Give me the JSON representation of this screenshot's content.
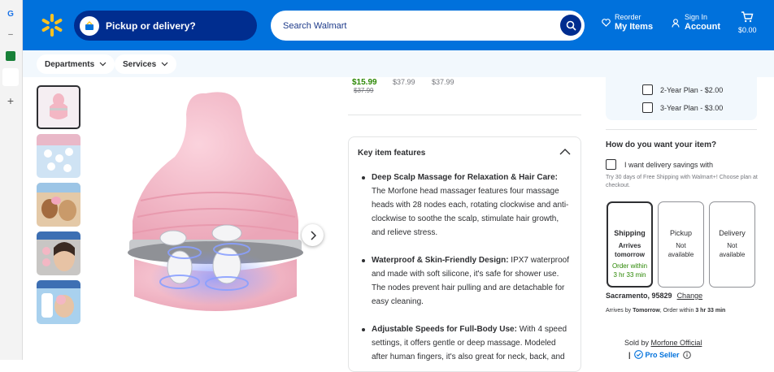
{
  "header": {
    "pickup_label": "Pickup or delivery?",
    "search_placeholder": "Search Walmart",
    "reorder_small": "Reorder",
    "reorder_big": "My Items",
    "signin_small": "Sign In",
    "signin_big": "Account",
    "cart_total": "$0.00"
  },
  "subnav": {
    "departments": "Departments",
    "services": "Services"
  },
  "prices": {
    "current": "$15.99",
    "was": "$37.99",
    "alt1": "$37.99",
    "alt2": "$37.99"
  },
  "key_features": {
    "title": "Key item features",
    "items": [
      {
        "bold": "Deep Scalp Massage for Relaxation & Hair Care:",
        "text": " The Morfone head massager features four massage heads with 28 nodes each, rotating clockwise and anti-clockwise to soothe the scalp, stimulate hair growth, and relieve stress."
      },
      {
        "bold": "Waterproof & Skin-Friendly Design:",
        "text": " IPX7 waterproof and made with soft silicone, it's safe for shower use. The nodes prevent hair pulling and are detachable for easy cleaning."
      },
      {
        "bold": "Adjustable Speeds for Full-Body Use:",
        "text": " With 4 speed settings, it offers gentle or deep massage. Modeled after human fingers, it's also great for neck, back, and"
      }
    ]
  },
  "protection": {
    "plan2": "2-Year Plan - $2.00",
    "plan3": "3-Year Plan - $3.00"
  },
  "fulfillment": {
    "question": "How do you want your item?",
    "savings_label": "I want delivery savings with",
    "savings_sub": "Try 30 days of Free Shipping with Walmart+! Choose plan at checkout.",
    "options": [
      {
        "name": "Shipping",
        "l1": "Arrives",
        "l2": "tomorrow",
        "l3": "Order within",
        "l4": "3 hr 33 min"
      },
      {
        "name": "Pickup",
        "l1": "Not",
        "l2": "available"
      },
      {
        "name": "Delivery",
        "l1": "Not",
        "l2": "available"
      }
    ],
    "location": "Sacramento, 95829",
    "change": "Change",
    "arrives_a": "Arrives by ",
    "arrives_b": "Tomorrow",
    "arrives_c": ", Order within ",
    "arrives_d": "3 hr 33 min",
    "sold_by": "Sold by ",
    "seller": "Morfone Official",
    "pro": "Pro Seller"
  },
  "colors": {
    "brand_blue": "#0071dc",
    "dark_blue": "#002d8f",
    "spark": "#ffc220",
    "price_green": "#2a8703"
  }
}
